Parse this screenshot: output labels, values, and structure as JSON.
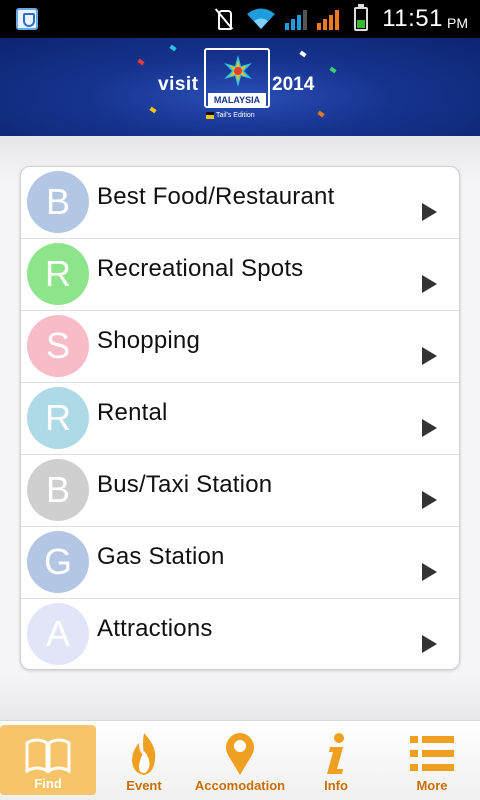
{
  "status_bar": {
    "time": "11:51",
    "ampm": "PM",
    "icons": [
      "app-shield-icon",
      "mute-icon",
      "wifi-icon",
      "signal-icon",
      "signal-icon",
      "battery-icon"
    ]
  },
  "banner": {
    "logo_visit": "visit",
    "logo_country": "MALAYSIA",
    "logo_year": "2014",
    "logo_edition": "Tail's Edition"
  },
  "categories": [
    {
      "letter": "B",
      "label": "Best Food/Restaurant",
      "color": "#b3c6e4"
    },
    {
      "letter": "R",
      "label": "Recreational Spots",
      "color": "#8ee48a"
    },
    {
      "letter": "S",
      "label": "Shopping",
      "color": "#f8bcc8"
    },
    {
      "letter": "R",
      "label": "Rental",
      "color": "#aed9e6"
    },
    {
      "letter": "B",
      "label": "Bus/Taxi Station",
      "color": "#cfcfcf"
    },
    {
      "letter": "G",
      "label": "Gas Station",
      "color": "#b3c6e4"
    },
    {
      "letter": "A",
      "label": "Attractions",
      "color": "#e2e4f8"
    }
  ],
  "tabs": [
    {
      "label": "Find",
      "icon": "book-icon",
      "active": true
    },
    {
      "label": "Event",
      "icon": "flame-icon",
      "active": false
    },
    {
      "label": "Accomodation",
      "icon": "map-pin-icon",
      "active": false
    },
    {
      "label": "Info",
      "icon": "info-icon",
      "active": false
    },
    {
      "label": "More",
      "icon": "list-icon",
      "active": false
    }
  ],
  "colors": {
    "accent": "#f0a020",
    "tab_label": "#c96e00",
    "banner": "#16338e"
  }
}
